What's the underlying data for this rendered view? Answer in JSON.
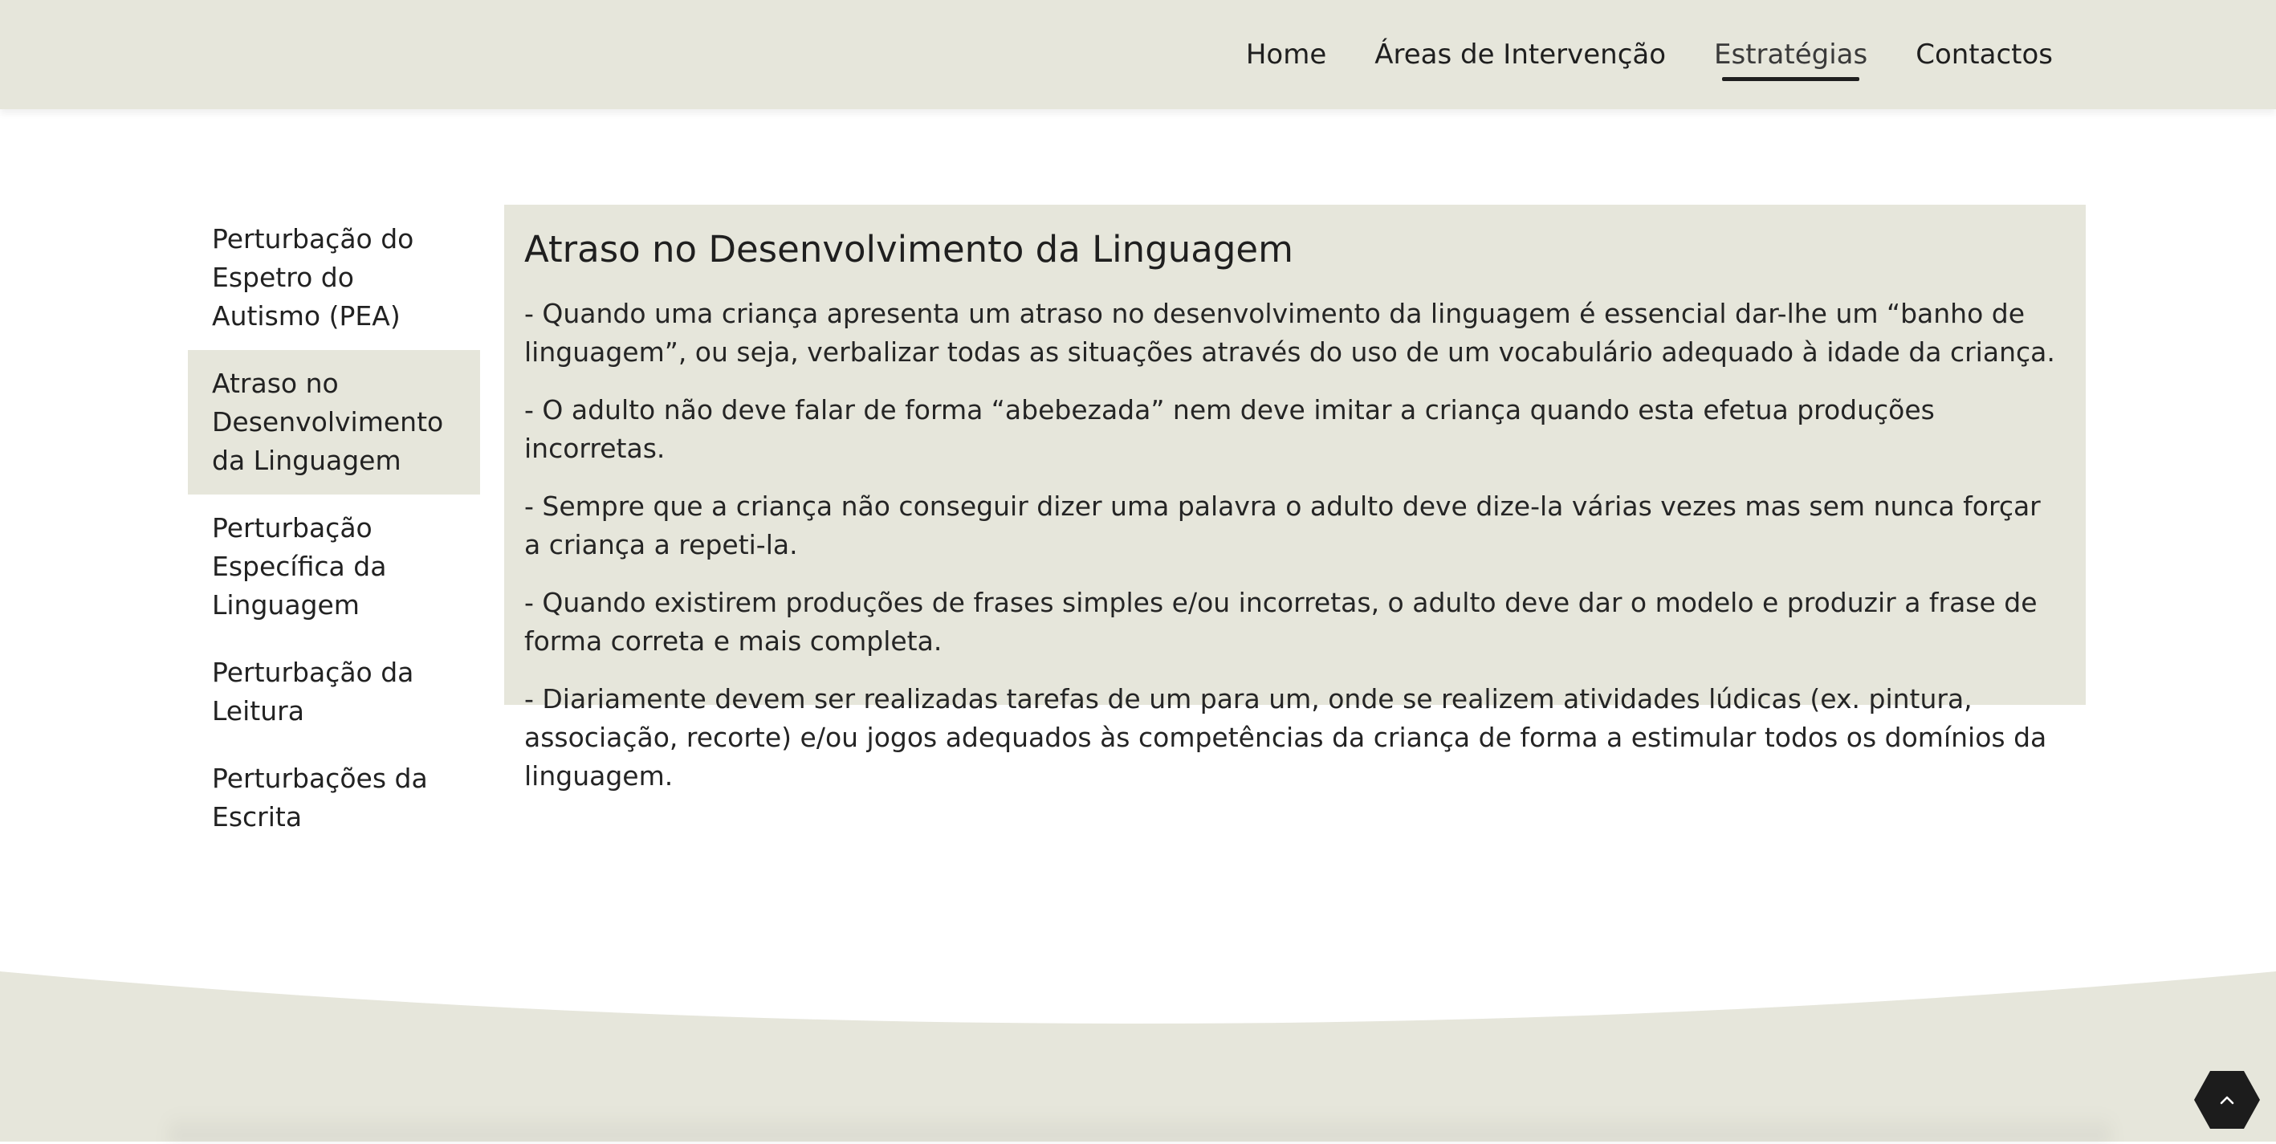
{
  "nav": {
    "items": [
      {
        "label": "Home"
      },
      {
        "label": "Áreas de Intervenção"
      },
      {
        "label": "Estratégias"
      },
      {
        "label": "Contactos"
      }
    ],
    "active_index": 2
  },
  "sidebar": {
    "items": [
      {
        "label": "Perturbação do Espetro do Autismo (PEA)"
      },
      {
        "label": "Atraso no Desenvolvimento da Linguagem"
      },
      {
        "label": "Perturbação Específica da Linguagem"
      },
      {
        "label": "Perturbação da Leitura"
      },
      {
        "label": "Perturbações da Escrita"
      }
    ],
    "active_index": 1
  },
  "content": {
    "title": "Atraso no Desenvolvimento da Linguagem",
    "paragraphs": [
      "- Quando uma criança apresenta um atraso no desenvolvimento da linguagem é essencial dar-lhe um “banho de linguagem”, ou seja, verbalizar todas as situações através do uso de um vocabulário adequado à idade da criança.",
      "- O adulto não deve falar de forma “abebezada” nem deve imitar a criança quando esta efetua produções incorretas.",
      "- Sempre que a criança não conseguir dizer uma palavra o adulto deve dize-la várias vezes mas sem nunca forçar a criança a repeti-la.",
      "- Quando existirem produções de frases simples e/ou incorretas, o adulto deve dar o modelo e produzir a frase de forma correta e mais completa.",
      "- Diariamente devem ser realizadas tarefas de um para um, onde se realizem atividades lúdicas (ex. pintura, associação, recorte) e/ou jogos adequados às competências da criança de forma a estimular todos os domínios da linguagem."
    ]
  },
  "colors": {
    "beige": "#e6e6db",
    "text": "#1f1f1f",
    "to_top_bg": "#1c1c1c"
  },
  "icons": {
    "to_top": "chevron-up-icon"
  }
}
